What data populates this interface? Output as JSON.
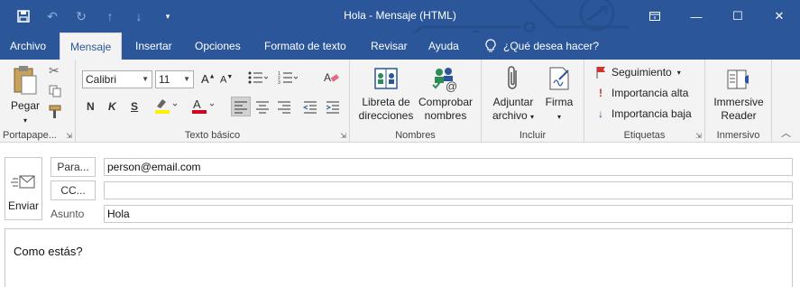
{
  "window": {
    "title": "Hola  -  Mensaje (HTML)",
    "controls": [
      "ribbon-display-icon",
      "minimize-icon",
      "maximize-icon",
      "close-icon"
    ]
  },
  "quick_access": [
    "save-icon",
    "undo-icon",
    "redo-icon",
    "up-icon",
    "down-icon",
    "customize-icon"
  ],
  "tabs": [
    {
      "label": "Archivo",
      "active": false
    },
    {
      "label": "Mensaje",
      "active": true
    },
    {
      "label": "Insertar",
      "active": false
    },
    {
      "label": "Opciones",
      "active": false
    },
    {
      "label": "Formato de texto",
      "active": false
    },
    {
      "label": "Revisar",
      "active": false
    },
    {
      "label": "Ayuda",
      "active": false
    }
  ],
  "tell_me": "¿Qué desea hacer?",
  "ribbon": {
    "clipboard": {
      "label": "Portapape...",
      "paste": "Pegar"
    },
    "basic_text": {
      "label": "Texto básico",
      "font": "Calibri",
      "size": "11",
      "bold": "N",
      "italic": "K",
      "underline": "S"
    },
    "names": {
      "label": "Nombres",
      "address_book_1": "Libreta de",
      "address_book_2": "direcciones",
      "check_names_1": "Comprobar",
      "check_names_2": "nombres"
    },
    "include": {
      "label": "Incluir",
      "attach_1": "Adjuntar",
      "attach_2": "archivo",
      "signature": "Firma"
    },
    "tags": {
      "label": "Etiquetas",
      "follow_up": "Seguimiento",
      "high": "Importancia alta",
      "low": "Importancia baja"
    },
    "immersive": {
      "label": "Inmersivo",
      "reader_1": "Immersive",
      "reader_2": "Reader"
    }
  },
  "compose": {
    "send": "Enviar",
    "to_label": "Para...",
    "to_value": "person@email.com",
    "cc_label": "CC...",
    "cc_value": "",
    "subject_label": "Asunto",
    "subject_value": "Hola",
    "body": "Como estás?"
  },
  "colors": {
    "accent": "#2b579a",
    "ribbon_bg": "#f3f3f3",
    "high_importance": "#c0392b",
    "low_importance": "#2b579a"
  }
}
